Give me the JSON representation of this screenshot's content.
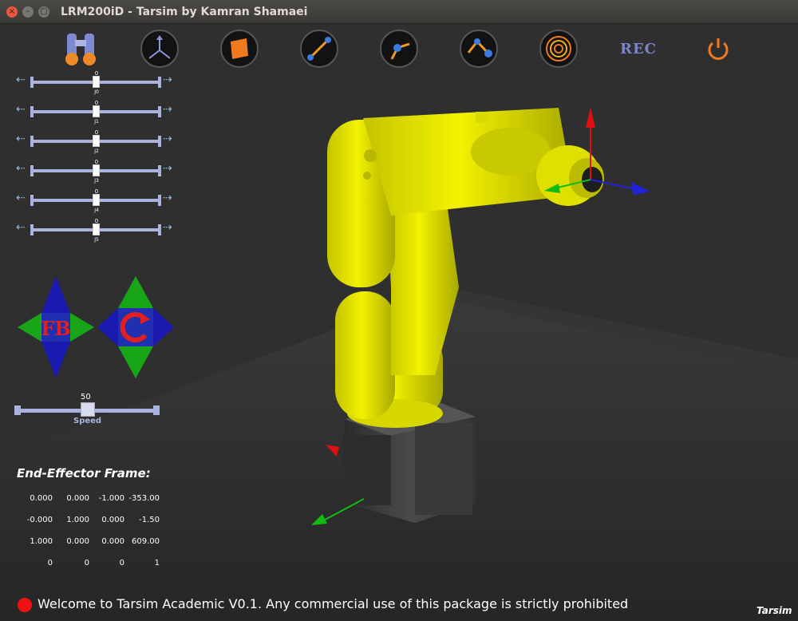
{
  "window": {
    "title": "LRM200iD - Tarsim by Kamran Shamaei",
    "close_glyph": "×",
    "minimize_glyph": "–",
    "maximize_glyph": "□"
  },
  "toolbar": {
    "rec_label": "REC",
    "icons": [
      "binoculars-icon",
      "axes-frame-icon",
      "plane-icon",
      "line-link-icon",
      "joint-link-icon",
      "two-link-icon",
      "spiral-icon",
      "rec-icon",
      "power-icon"
    ]
  },
  "joints": [
    {
      "label": "J0",
      "value": "0"
    },
    {
      "label": "J1",
      "value": "0"
    },
    {
      "label": "J2",
      "value": "0"
    },
    {
      "label": "J3",
      "value": "0"
    },
    {
      "label": "J4",
      "value": "0"
    },
    {
      "label": "J5",
      "value": "0"
    }
  ],
  "controls": {
    "fb_label": "FB"
  },
  "speed": {
    "value": "50",
    "label": "Speed",
    "fraction": 0.5
  },
  "end_effector": {
    "title": "End-Effector Frame:",
    "matrix": [
      [
        "0.000",
        "0.000",
        "-1.000",
        "-353.00"
      ],
      [
        "-0.000",
        "1.000",
        "0.000",
        "-1.50"
      ],
      [
        "1.000",
        "0.000",
        "0.000",
        "609.00"
      ],
      [
        "0",
        "0",
        "0",
        "1"
      ]
    ]
  },
  "status": {
    "message": "Welcome to Tarsim Academic V0.1. Any commercial use of this package is strictly prohibited",
    "indicator_color": "#f01010"
  },
  "brand": "Tarsim",
  "colors": {
    "robot": "#e6e600",
    "base": "#3d3d3d",
    "axis_x": "#2222dd",
    "axis_y": "#11bb11",
    "axis_z": "#dd1111"
  }
}
